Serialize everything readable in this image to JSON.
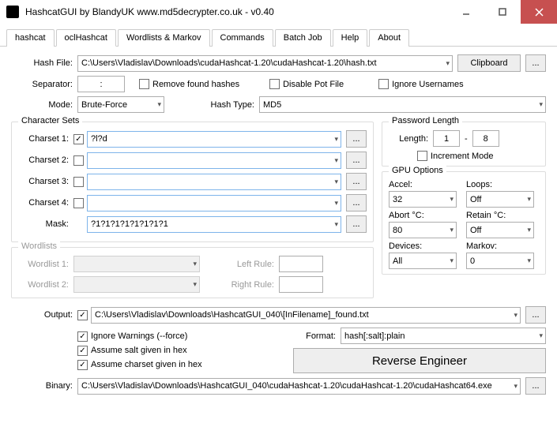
{
  "window": {
    "title": "HashcatGUI by BlandyUK www.md5decrypter.co.uk - v0.40"
  },
  "tabs": [
    "hashcat",
    "oclHashcat",
    "Wordlists & Markov",
    "Commands",
    "Batch Job",
    "Help",
    "About"
  ],
  "active_tab": 1,
  "hashfile": {
    "label": "Hash File:",
    "value": "C:\\Users\\Vladislav\\Downloads\\cudaHashcat-1.20\\cudaHashcat-1.20\\hash.txt",
    "clipboard": "Clipboard",
    "more": "..."
  },
  "separator": {
    "label": "Separator:",
    "value": ":",
    "remove": "Remove found hashes",
    "disable_pot": "Disable Pot File",
    "ignore_user": "Ignore Usernames"
  },
  "mode": {
    "label": "Mode:",
    "value": "Brute-Force",
    "hashtype_label": "Hash Type:",
    "hashtype": "MD5"
  },
  "charsets": {
    "legend": "Character Sets",
    "c1": {
      "label": "Charset 1:",
      "on": true,
      "value": "?l?d"
    },
    "c2": {
      "label": "Charset 2:",
      "on": false,
      "value": ""
    },
    "c3": {
      "label": "Charset 3:",
      "on": false,
      "value": ""
    },
    "c4": {
      "label": "Charset 4:",
      "on": false,
      "value": ""
    },
    "mask": {
      "label": "Mask:",
      "value": "?1?1?1?1?1?1?1?1"
    },
    "more": "..."
  },
  "pwdlen": {
    "legend": "Password Length",
    "label": "Length:",
    "from": "1",
    "sep": "-",
    "to": "8",
    "incr": "Increment Mode"
  },
  "gpu": {
    "legend": "GPU Options",
    "accel": {
      "label": "Accel:",
      "value": "32"
    },
    "loops": {
      "label": "Loops:",
      "value": "Off"
    },
    "abort": {
      "label": "Abort °C:",
      "value": "80"
    },
    "retain": {
      "label": "Retain °C:",
      "value": "Off"
    },
    "devices": {
      "label": "Devices:",
      "value": "All"
    },
    "markov": {
      "label": "Markov:",
      "value": "0"
    }
  },
  "wordlists": {
    "legend": "Wordlists",
    "w1": "Wordlist 1:",
    "w2": "Wordlist 2:",
    "lr": "Left Rule:",
    "rr": "Right Rule:"
  },
  "output": {
    "label": "Output:",
    "on": true,
    "value": "C:\\Users\\Vladislav\\Downloads\\HashcatGUI_040\\[InFilename]_found.txt",
    "more": "..."
  },
  "opts": {
    "ignore": "Ignore Warnings (--force)",
    "salt_hex": "Assume salt given in hex",
    "charset_hex": "Assume charset given in hex"
  },
  "format": {
    "label": "Format:",
    "value": "hash[:salt]:plain"
  },
  "binary": {
    "label": "Binary:",
    "value": "C:\\Users\\Vladislav\\Downloads\\HashcatGUI_040\\cudaHashcat-1.20\\cudaHashcat-1.20\\cudaHashcat64.exe",
    "more": "..."
  },
  "reverse": "Reverse Engineer"
}
